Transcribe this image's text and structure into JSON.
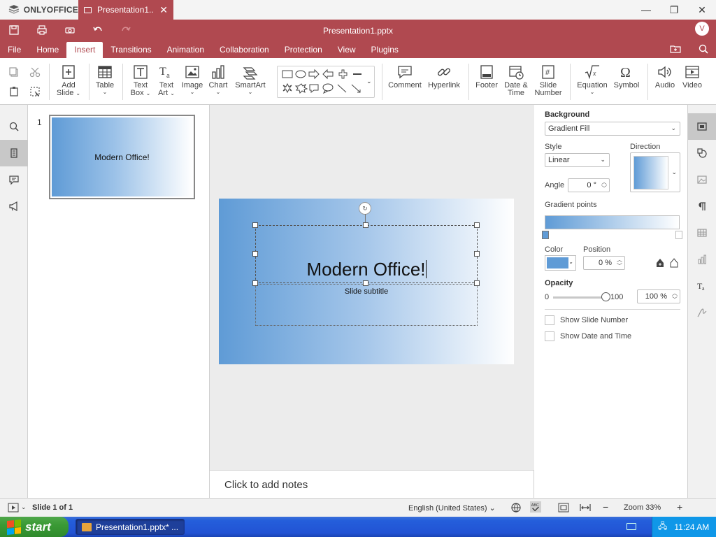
{
  "app": {
    "brand": "ONLYOFFICE",
    "tab_label": "Presentation1....",
    "doc_title": "Presentation1.pptx",
    "avatar": "V"
  },
  "menu": {
    "tabs": [
      "File",
      "Home",
      "Insert",
      "Transitions",
      "Animation",
      "Collaboration",
      "Protection",
      "View",
      "Plugins"
    ],
    "active": "Insert"
  },
  "toolbar": {
    "add_slide": [
      "Add",
      "Slide"
    ],
    "table": "Table",
    "text_box": [
      "Text",
      "Box"
    ],
    "text_art": [
      "Text",
      "Art"
    ],
    "image": "Image",
    "chart": "Chart",
    "smartart": "SmartArt",
    "comment": "Comment",
    "hyperlink": "Hyperlink",
    "footer": "Footer",
    "date_time": [
      "Date &",
      "Time"
    ],
    "slide_number": [
      "Slide",
      "Number"
    ],
    "equation": "Equation",
    "symbol": "Symbol",
    "audio": "Audio",
    "video": "Video"
  },
  "thumbnails": [
    {
      "number": "1",
      "title": "Modern Office!"
    }
  ],
  "slide": {
    "title": "Modern Office!",
    "subtitle": "Slide subtitle"
  },
  "notes_placeholder": "Click to add notes",
  "background_panel": {
    "heading": "Background",
    "fill_type": "Gradient Fill",
    "style_label": "Style",
    "style_value": "Linear",
    "direction_label": "Direction",
    "angle_label": "Angle",
    "angle_value": "0 °",
    "gradient_points_label": "Gradient points",
    "color_label": "Color",
    "position_label": "Position",
    "position_value": "0 %",
    "opacity_label": "Opacity",
    "opacity_min": "0",
    "opacity_max": "100",
    "opacity_value": "100 %",
    "opacity_fraction": 1.0,
    "show_slide_number": "Show Slide Number",
    "show_date_time": "Show Date and Time",
    "color_hex": "#5f9bd6"
  },
  "status": {
    "slide_counter": "Slide 1 of 1",
    "language": "English (United States)",
    "zoom": "Zoom 33%"
  },
  "taskbar": {
    "start": "start",
    "task": "Presentation1.pptx* ...",
    "clock": "11:24 AM"
  },
  "colors": {
    "accent": "#b04950",
    "gradient_start": "#5f9bd6",
    "gradient_end": "#ffffff"
  }
}
